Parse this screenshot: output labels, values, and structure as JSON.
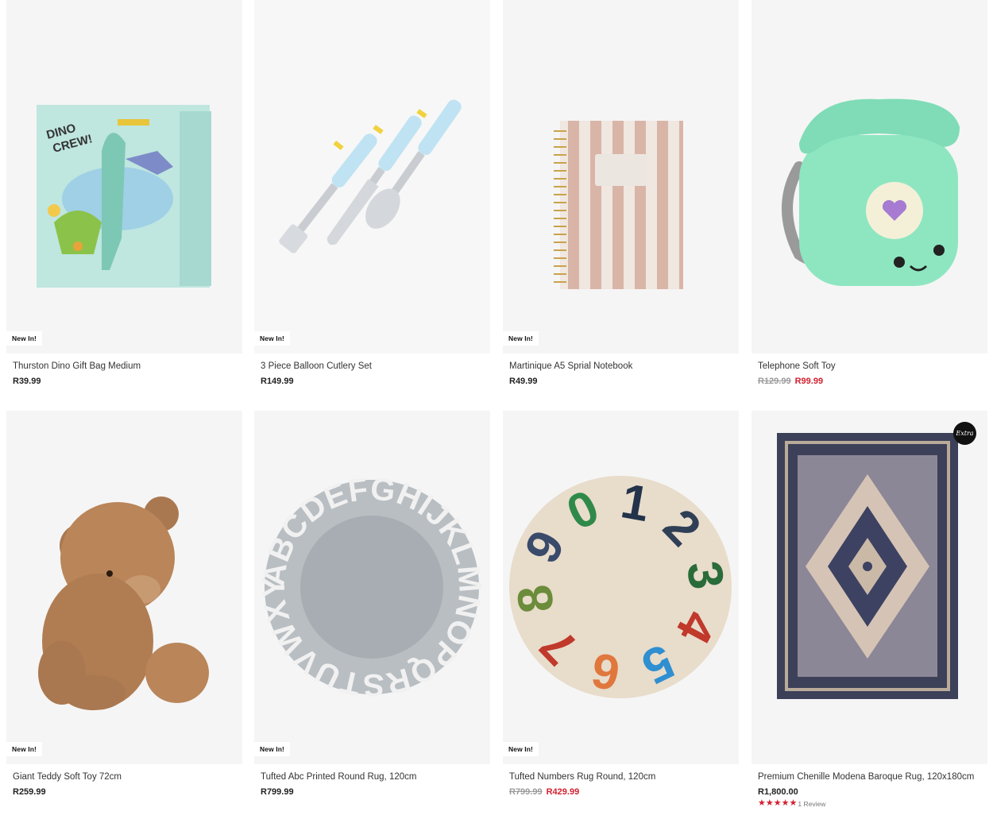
{
  "products": [
    {
      "name": "Thurston Dino Gift Bag Medium",
      "badge": "New In!",
      "price": "R39.99",
      "image_icon": "dino-gift-bag-image"
    },
    {
      "name": "3 Piece Balloon Cutlery Set",
      "badge": "New In!",
      "price": "R149.99",
      "image_icon": "cutlery-set-image"
    },
    {
      "name": "Martinique A5 Sprial Notebook",
      "badge": "New In!",
      "price": "R49.99",
      "image_icon": "notebook-image"
    },
    {
      "name": "Telephone Soft Toy",
      "price_was": "R129.99",
      "price_now": "R99.99",
      "image_icon": "telephone-toy-image"
    },
    {
      "name": "Giant Teddy Soft Toy 72cm",
      "badge": "New In!",
      "price": "R259.99",
      "image_icon": "teddy-bear-image"
    },
    {
      "name": "Tufted Abc Printed Round Rug, 120cm",
      "badge": "New In!",
      "price": "R799.99",
      "image_icon": "abc-rug-image"
    },
    {
      "name": "Tufted Numbers Rug Round, 120cm",
      "badge": "New In!",
      "price_was": "R799.99",
      "price_now": "R429.99",
      "image_icon": "numbers-rug-image"
    },
    {
      "name": "Premium Chenille Modena Baroque Rug, 120x180cm",
      "price": "R1,800.00",
      "extra_badge": "Extra",
      "rating": 5,
      "review_count": "1 Review",
      "image_icon": "baroque-rug-image"
    }
  ],
  "colors": {
    "sale": "#d2202f",
    "tile_bg": "#f5f5f5",
    "was_price": "#9a9a9a"
  },
  "abc_letters": "ABCDEFGHIJKLMNOPQRSTUVWXYZ",
  "number_digits": [
    "1",
    "2",
    "3",
    "4",
    "5",
    "6",
    "7",
    "8",
    "9",
    "0"
  ]
}
